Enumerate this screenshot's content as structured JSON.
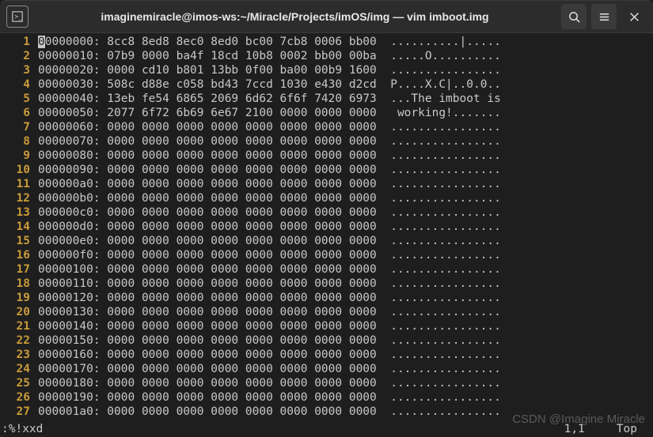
{
  "window": {
    "title": "imaginemiracle@imos-ws:~/Miracle/Projects/imOS/img — vim imboot.img"
  },
  "lines": [
    {
      "n": "1",
      "offset": "00000000:",
      "hex": "8cc8 8ed8 8ec0 8ed0 bc00 7cb8 0006 bb00",
      "ascii": "..........|....."
    },
    {
      "n": "2",
      "offset": "00000010:",
      "hex": "07b9 0000 ba4f 18cd 10b8 0002 bb00 00ba",
      "ascii": ".....O.........."
    },
    {
      "n": "3",
      "offset": "00000020:",
      "hex": "0000 cd10 b801 13bb 0f00 ba00 00b9 1600",
      "ascii": "................"
    },
    {
      "n": "4",
      "offset": "00000030:",
      "hex": "508c d88e c058 bd43 7ccd 1030 e430 d2cd",
      "ascii": "P....X.C|..0.0.."
    },
    {
      "n": "5",
      "offset": "00000040:",
      "hex": "13eb fe54 6865 2069 6d62 6f6f 7420 6973",
      "ascii": "...The imboot is"
    },
    {
      "n": "6",
      "offset": "00000050:",
      "hex": "2077 6f72 6b69 6e67 2100 0000 0000 0000",
      "ascii": " working!......."
    },
    {
      "n": "7",
      "offset": "00000060:",
      "hex": "0000 0000 0000 0000 0000 0000 0000 0000",
      "ascii": "................"
    },
    {
      "n": "8",
      "offset": "00000070:",
      "hex": "0000 0000 0000 0000 0000 0000 0000 0000",
      "ascii": "................"
    },
    {
      "n": "9",
      "offset": "00000080:",
      "hex": "0000 0000 0000 0000 0000 0000 0000 0000",
      "ascii": "................"
    },
    {
      "n": "10",
      "offset": "00000090:",
      "hex": "0000 0000 0000 0000 0000 0000 0000 0000",
      "ascii": "................"
    },
    {
      "n": "11",
      "offset": "000000a0:",
      "hex": "0000 0000 0000 0000 0000 0000 0000 0000",
      "ascii": "................"
    },
    {
      "n": "12",
      "offset": "000000b0:",
      "hex": "0000 0000 0000 0000 0000 0000 0000 0000",
      "ascii": "................"
    },
    {
      "n": "13",
      "offset": "000000c0:",
      "hex": "0000 0000 0000 0000 0000 0000 0000 0000",
      "ascii": "................"
    },
    {
      "n": "14",
      "offset": "000000d0:",
      "hex": "0000 0000 0000 0000 0000 0000 0000 0000",
      "ascii": "................"
    },
    {
      "n": "15",
      "offset": "000000e0:",
      "hex": "0000 0000 0000 0000 0000 0000 0000 0000",
      "ascii": "................"
    },
    {
      "n": "16",
      "offset": "000000f0:",
      "hex": "0000 0000 0000 0000 0000 0000 0000 0000",
      "ascii": "................"
    },
    {
      "n": "17",
      "offset": "00000100:",
      "hex": "0000 0000 0000 0000 0000 0000 0000 0000",
      "ascii": "................"
    },
    {
      "n": "18",
      "offset": "00000110:",
      "hex": "0000 0000 0000 0000 0000 0000 0000 0000",
      "ascii": "................"
    },
    {
      "n": "19",
      "offset": "00000120:",
      "hex": "0000 0000 0000 0000 0000 0000 0000 0000",
      "ascii": "................"
    },
    {
      "n": "20",
      "offset": "00000130:",
      "hex": "0000 0000 0000 0000 0000 0000 0000 0000",
      "ascii": "................"
    },
    {
      "n": "21",
      "offset": "00000140:",
      "hex": "0000 0000 0000 0000 0000 0000 0000 0000",
      "ascii": "................"
    },
    {
      "n": "22",
      "offset": "00000150:",
      "hex": "0000 0000 0000 0000 0000 0000 0000 0000",
      "ascii": "................"
    },
    {
      "n": "23",
      "offset": "00000160:",
      "hex": "0000 0000 0000 0000 0000 0000 0000 0000",
      "ascii": "................"
    },
    {
      "n": "24",
      "offset": "00000170:",
      "hex": "0000 0000 0000 0000 0000 0000 0000 0000",
      "ascii": "................"
    },
    {
      "n": "25",
      "offset": "00000180:",
      "hex": "0000 0000 0000 0000 0000 0000 0000 0000",
      "ascii": "................"
    },
    {
      "n": "26",
      "offset": "00000190:",
      "hex": "0000 0000 0000 0000 0000 0000 0000 0000",
      "ascii": "................"
    },
    {
      "n": "27",
      "offset": "000001a0:",
      "hex": "0000 0000 0000 0000 0000 0000 0000 0000",
      "ascii": "................"
    }
  ],
  "status": {
    "command": ":%!xxd",
    "position": "1,1",
    "scroll": "Top"
  },
  "watermark": "CSDN @Imagine Miracle"
}
